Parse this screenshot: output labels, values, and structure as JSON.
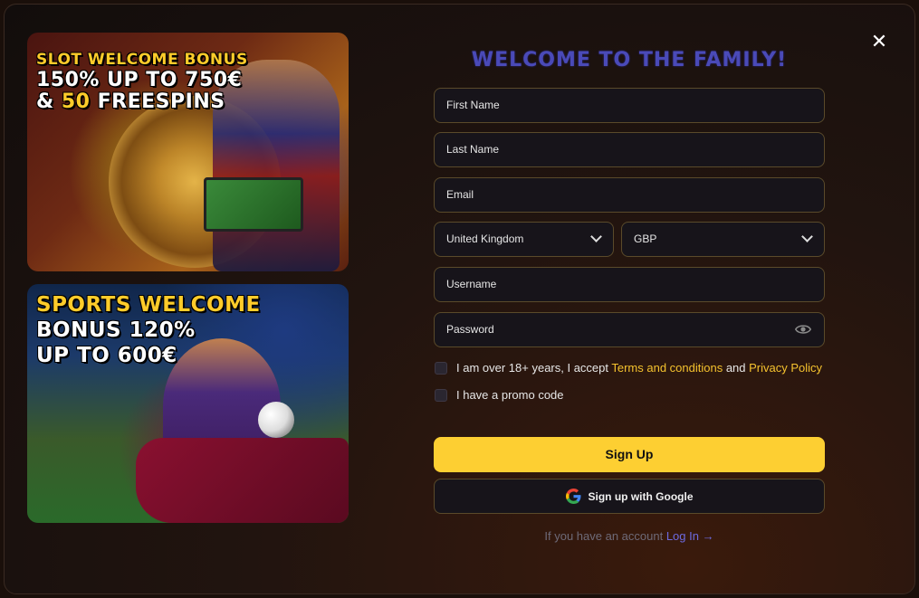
{
  "banners": {
    "slot": {
      "line1": "SLOT WELCOME BONUS",
      "line2": "150% UP TO 750€",
      "line3_amp": "& ",
      "line3_num": "50",
      "line3_rest": " FREESPINS"
    },
    "sport": {
      "line1": "SPORTS WELCOME",
      "line2": "BONUS 120%",
      "line3": "UP TO 600€"
    }
  },
  "form": {
    "title": "WELCOME TO THE FAMILY!",
    "first_name_placeholder": "First Name",
    "last_name_placeholder": "Last Name",
    "email_placeholder": "Email",
    "country_value": "United Kingdom",
    "currency_value": "GBP",
    "username_placeholder": "Username",
    "password_placeholder": "Password",
    "age_check_prefix": "I am over 18+ years, I accept ",
    "terms_link": "Terms and conditions",
    "age_check_and": " and ",
    "privacy_link": "Privacy Policy",
    "promo_check": "I have a promo code",
    "signup_label": "Sign Up",
    "google_label": "Sign up with Google",
    "login_prompt": "If you have an account ",
    "login_link": "Log In",
    "login_arrow": "→"
  },
  "icons": {
    "close": "close-icon",
    "eye": "eye-icon",
    "chevron": "chevron-down-icon",
    "google": "google-icon"
  },
  "colors": {
    "accent_yellow": "#fdcf32",
    "title_blue": "#4a4ab8",
    "link_purple": "#6d6ae0"
  }
}
